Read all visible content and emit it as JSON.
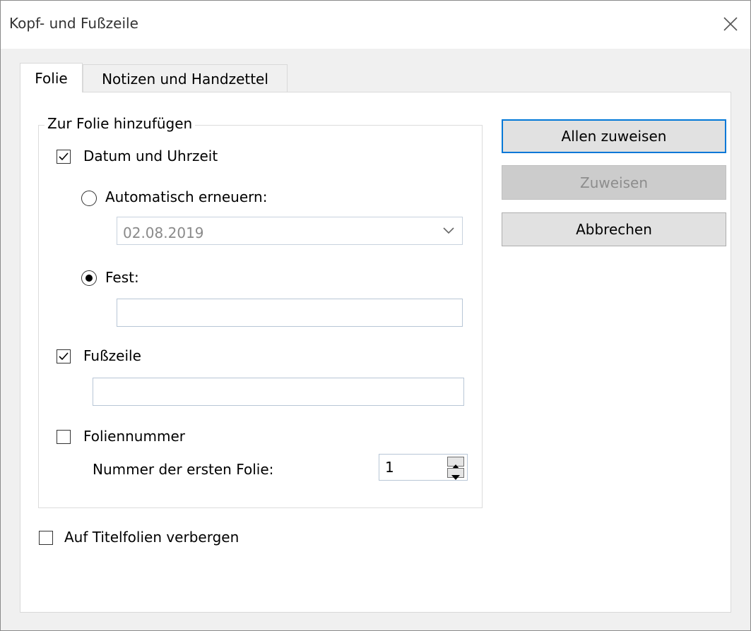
{
  "window": {
    "title": "Kopf- und Fußzeile"
  },
  "tabs": [
    {
      "label": "Folie",
      "active": true
    },
    {
      "label": "Notizen und Handzettel",
      "active": false
    }
  ],
  "group": {
    "legend": "Zur Folie hinzufügen",
    "datetime": {
      "label": "Datum und Uhrzeit",
      "checked": true,
      "auto": {
        "label": "Automatisch erneuern:",
        "selected": false
      },
      "date_value": "02.08.2019",
      "fixed": {
        "label": "Fest:",
        "selected": true
      },
      "fixed_value": ""
    },
    "footer": {
      "label": "Fußzeile",
      "checked": true,
      "value": ""
    },
    "slide_number": {
      "label": "Foliennummer",
      "checked": false,
      "start_label": "Nummer der ersten Folie:",
      "start_value": "1"
    }
  },
  "hide_on_title": {
    "label": "Auf Titelfolien verbergen",
    "checked": false
  },
  "buttons": {
    "apply_all": "Allen zuweisen",
    "apply": "Zuweisen",
    "cancel": "Abbrechen"
  }
}
